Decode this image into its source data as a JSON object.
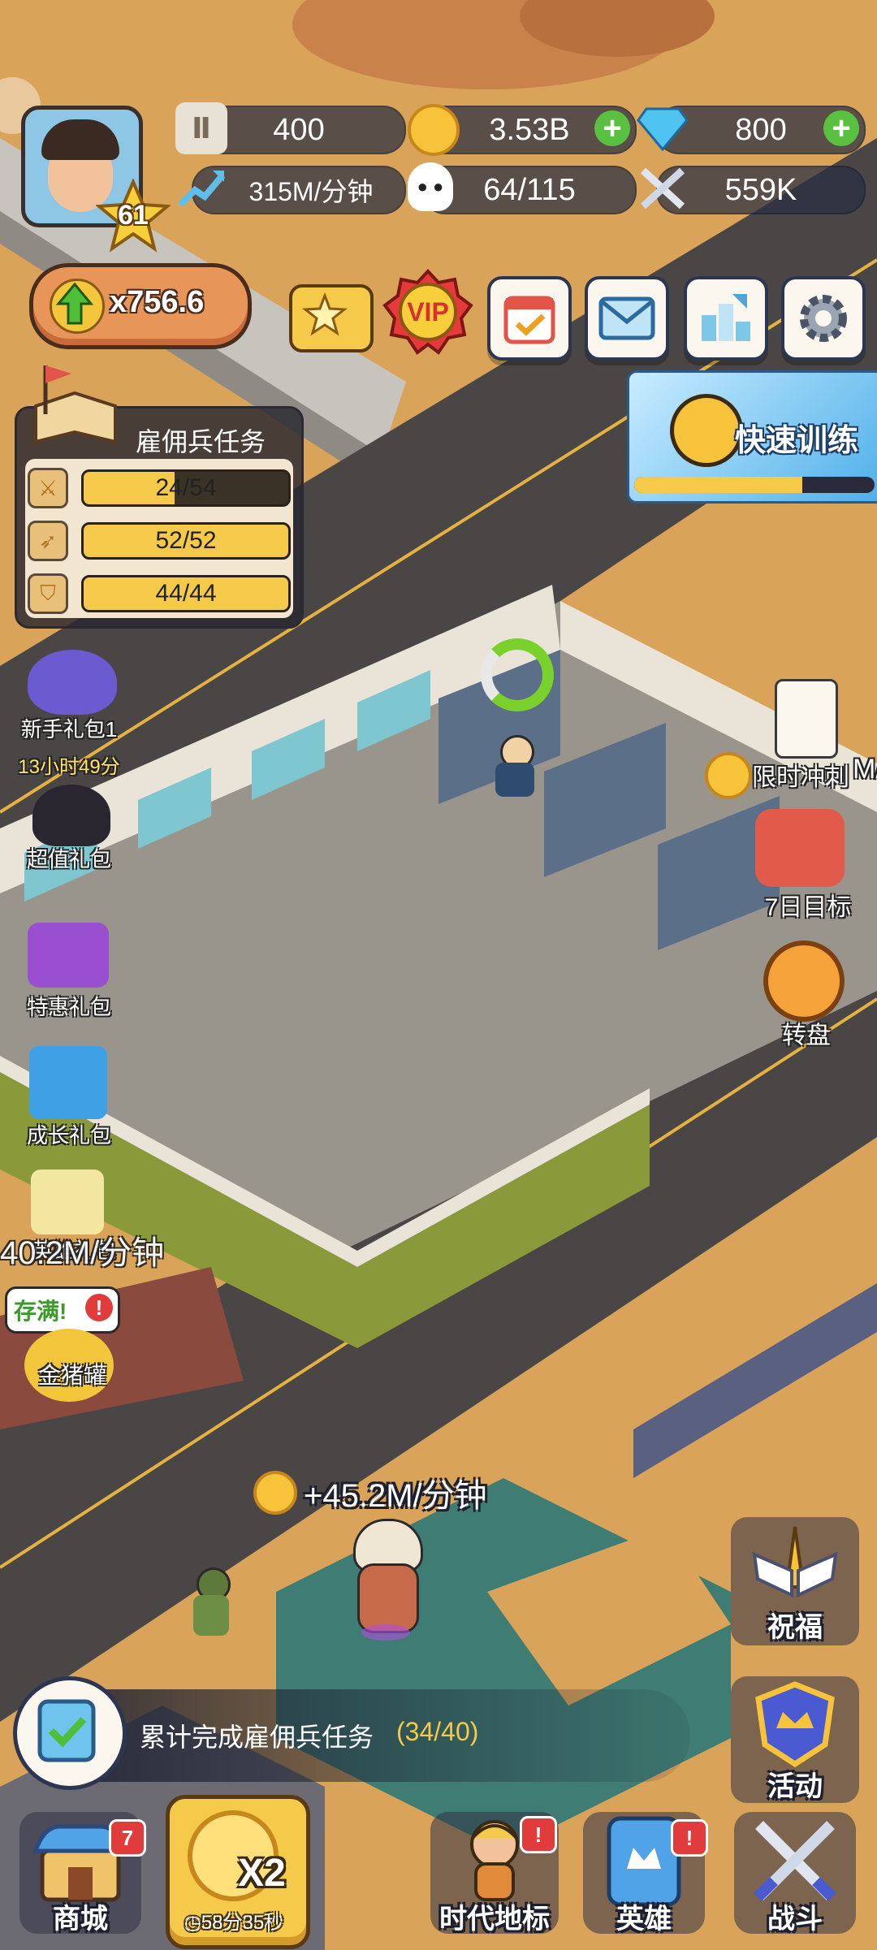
{
  "player": {
    "level": "61"
  },
  "resources": {
    "stone": "400",
    "gold": "3.53B",
    "gems": "800",
    "income_rate": "315M/分钟",
    "population": "64/115",
    "power": "559K"
  },
  "boost": {
    "multiplier": "x756.6"
  },
  "top_buttons": {
    "vip_label": "VIP"
  },
  "training": {
    "label": "快速训练",
    "progress": 0.7
  },
  "mercenary_tasks": {
    "title": "雇佣兵任务",
    "rows": [
      {
        "icon": "sword-icon",
        "text": "24/54",
        "progress": 0.444
      },
      {
        "icon": "bow-icon",
        "text": "52/52",
        "progress": 1.0
      },
      {
        "icon": "shield-icon",
        "text": "44/44",
        "progress": 1.0
      }
    ]
  },
  "left_packs": {
    "newbie": {
      "label": "新手礼包1",
      "timer": "13小时49分"
    },
    "value": {
      "label": "超值礼包"
    },
    "special": {
      "label": "特惠礼包"
    },
    "growth": {
      "label": "成长礼包"
    },
    "hero_pack": {
      "label": "英雄礼包"
    },
    "overlay_text": "40.2M/分钟",
    "piggy": {
      "status": "存满!",
      "label": "金猪罐"
    }
  },
  "right_events": {
    "sprint": {
      "label": "限时冲刺",
      "suffix": "M/"
    },
    "seven_day": {
      "label": "7日目标"
    },
    "wheel": {
      "label": "转盘"
    },
    "blessing": {
      "label": "祝福"
    },
    "activity": {
      "label": "活动"
    }
  },
  "income_popup": "+45.2M/分钟",
  "task_banner": {
    "text": "累计完成雇佣兵任务",
    "count": "(34/40)"
  },
  "bottom_nav": {
    "shop": {
      "label": "商城",
      "badge": "7"
    },
    "boost": {
      "label": "X2",
      "timer": "58分35秒"
    },
    "landmark": {
      "label": "时代地标",
      "badge": "!"
    },
    "heroes": {
      "label": "英雄",
      "badge": "!"
    },
    "battle": {
      "label": "战斗"
    }
  },
  "colors": {
    "sand": "#d9a35a",
    "road": "#4a4646",
    "accent_gold": "#f5c94a",
    "progress_green": "#59c13f",
    "badge_red": "#e23b3b"
  }
}
